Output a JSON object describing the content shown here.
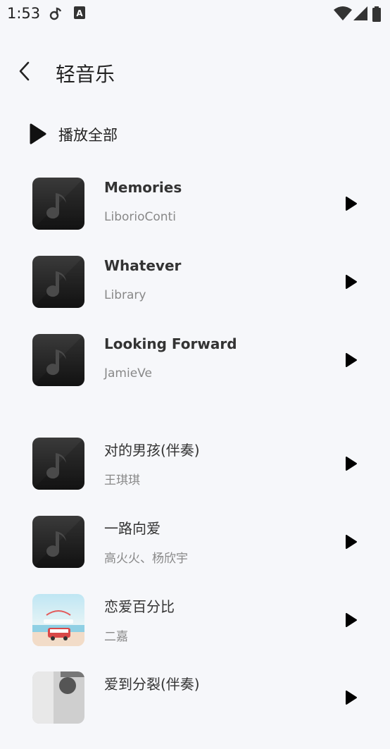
{
  "status_bar": {
    "time": "1:53"
  },
  "header": {
    "title": "轻音乐"
  },
  "play_all": {
    "label": "播放全部"
  },
  "songs": [
    {
      "name": "Memories",
      "artist": "LiborioConti"
    },
    {
      "name": "Whatever",
      "artist": "Library"
    },
    {
      "name": "Looking Forward",
      "artist": "JamieVe"
    },
    {
      "name": "对的男孩(伴奏)",
      "artist": "王琪琪"
    },
    {
      "name": "一路向爱",
      "artist": "高火火、杨欣宇"
    },
    {
      "name": "恋爱百分比",
      "artist": "二嘉"
    },
    {
      "name": "爱到分裂(伴奏)",
      "artist": ""
    }
  ],
  "icons": {
    "back": "chevron-left-icon",
    "play": "play-icon",
    "placeholder_cover": "music-note-icon",
    "wifi": "wifi-icon",
    "signal": "signal-icon"
  },
  "colors": {
    "background": "#f6f7fa",
    "title_text": "#222222",
    "artist_text": "#888888",
    "cover_dark": "#2a2a2a"
  }
}
